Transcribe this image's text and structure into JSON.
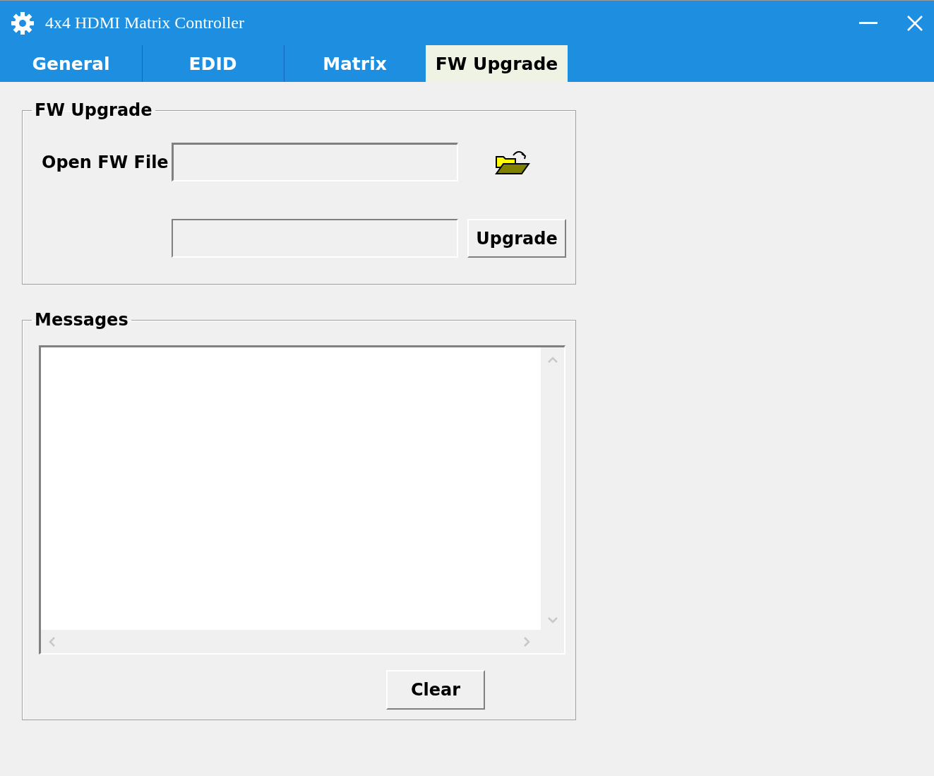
{
  "window": {
    "title": "4x4 HDMI Matrix Controller"
  },
  "tabs": [
    {
      "label": "General",
      "selected": false
    },
    {
      "label": "EDID",
      "selected": false
    },
    {
      "label": "Matrix",
      "selected": false
    },
    {
      "label": "FW Upgrade",
      "selected": true
    }
  ],
  "fw_upgrade": {
    "title": "FW Upgrade",
    "open_file_label": "Open FW File",
    "upgrade_button": "Upgrade"
  },
  "messages": {
    "title": "Messages",
    "clear_button": "Clear"
  }
}
